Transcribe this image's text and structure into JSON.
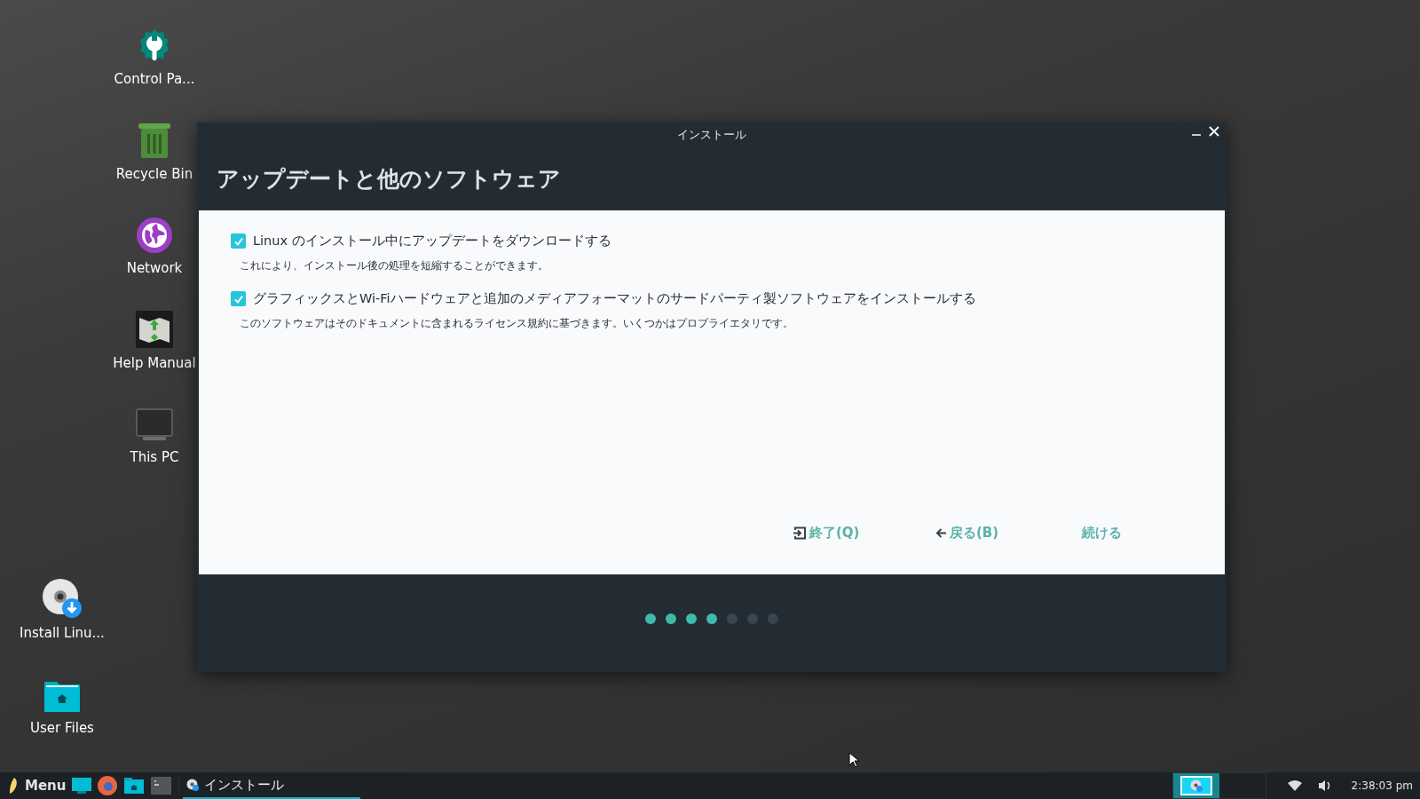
{
  "desktop_icons_top": [
    {
      "label": "Control Pa...",
      "kind": "control"
    },
    {
      "label": "Recycle Bin",
      "kind": "trash"
    },
    {
      "label": "Network",
      "kind": "network"
    },
    {
      "label": "Help Manual",
      "kind": "help"
    },
    {
      "label": "This PC",
      "kind": "pc"
    }
  ],
  "desktop_icons_bottom": [
    {
      "label": "Install Linu...",
      "kind": "install"
    },
    {
      "label": "User Files",
      "kind": "folder"
    }
  ],
  "window": {
    "title": "インストール",
    "heading": "アップデートと他のソフトウェア",
    "options": [
      {
        "label": "Linux のインストール中にアップデートをダウンロードする",
        "checked": true,
        "description": "これにより、インストール後の処理を短縮することができます。"
      },
      {
        "label": "グラフィックスとWi-Fiハードウェアと追加のメディアフォーマットのサードパーティ製ソフトウェアをインストールする",
        "checked": true,
        "description": "このソフトウェアはそのドキュメントに含まれるライセンス規約に基づきます。いくつかはプロプライエタリです。"
      }
    ],
    "buttons": [
      {
        "label": "終了(Q)",
        "kind": "quit"
      },
      {
        "label": "戻る(B)",
        "kind": "back"
      },
      {
        "label": "続ける",
        "kind": "next"
      }
    ],
    "steps": [
      {
        "done": true
      },
      {
        "done": true
      },
      {
        "done": true
      },
      {
        "done": true
      },
      {
        "done": false
      },
      {
        "done": false
      },
      {
        "done": false
      }
    ]
  },
  "taskbar": {
    "menu": "Menu",
    "task": {
      "label": "インストール",
      "selected": true
    },
    "clock": "2:38:03 pm"
  }
}
